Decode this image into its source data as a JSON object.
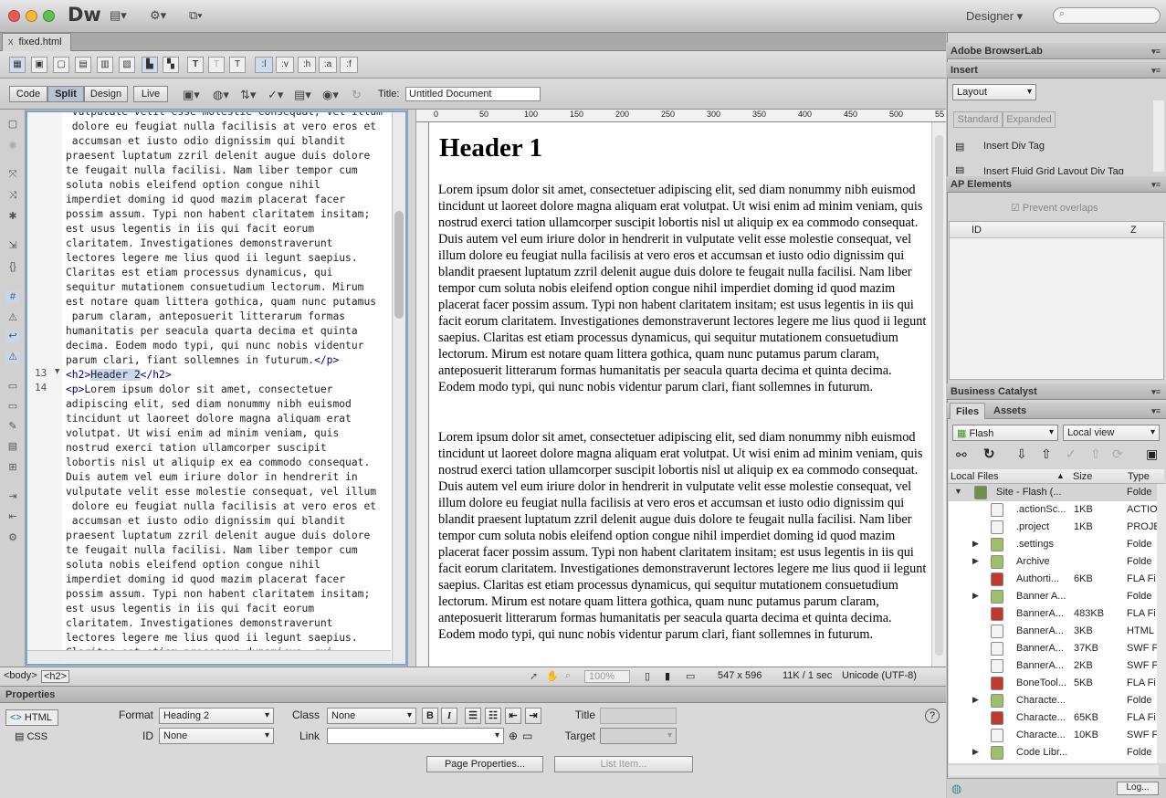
{
  "app": {
    "logo": "Dw",
    "workspace": "Designer",
    "search_placeholder": ""
  },
  "document": {
    "tab_name": "fixed.html",
    "tab_close": "x"
  },
  "insert_bar": {
    "tag_buttons": [
      ":l",
      ":v",
      ":h",
      ":a",
      ":f"
    ]
  },
  "doc_toolbar": {
    "code": "Code",
    "split": "Split",
    "design": "Design",
    "live": "Live",
    "title_label": "Title:",
    "title_value": "Untitled Document"
  },
  "code_view": {
    "line_13": "13",
    "line_14": "14",
    "text_before": " vulputate velit esse molestie consequat, vel illum\n dolore eu feugiat nulla facilisis at vero eros et\n accumsan et iusto odio dignissim qui blandit\npraesent luptatum zzril delenit augue duis dolore\nte feugait nulla facilisi. Nam liber tempor cum\nsoluta nobis eleifend option congue nihil\nimperdiet doming id quod mazim placerat facer\npossim assum. Typi non habent claritatem insitam;\nest usus legentis in iis qui facit eorum\nclaritatem. Investigationes demonstraverunt\nlectores legere me lius quod ii legunt saepius.\nClaritas est etiam processus dynamicus, qui\nsequitur mutationem consuetudium lectorum. Mirum\nest notare quam littera gothica, quam nunc putamus\n parum claram, anteposuerit litterarum formas\nhumanitatis per seacula quarta decima et quinta\ndecima. Eodem modo typi, qui nunc nobis videntur\nparum clari, fiant sollemnes in futurum.",
    "end_p": "</p>",
    "h2_open": "<h2>",
    "h2_text": "Header 2",
    "h2_close": "</h2>",
    "p_open": "<p>",
    "text_after_first": "Lorem ipsum dolor sit amet, consectetuer",
    "text_after": "adipiscing elit, sed diam nonummy nibh euismod\ntincidunt ut laoreet dolore magna aliquam erat\nvolutpat. Ut wisi enim ad minim veniam, quis\nnostrud exerci tation ullamcorper suscipit\nlobortis nisl ut aliquip ex ea commodo consequat.\nDuis autem vel eum iriure dolor in hendrerit in\nvulputate velit esse molestie consequat, vel illum\n dolore eu feugiat nulla facilisis at vero eros et\n accumsan et iusto odio dignissim qui blandit\npraesent luptatum zzril delenit augue duis dolore\nte feugait nulla facilisi. Nam liber tempor cum\nsoluta nobis eleifend option congue nihil\nimperdiet doming id quod mazim placerat facer\npossim assum. Typi non habent claritatem insitam;\nest usus legentis in iis qui facit eorum\nclaritatem. Investigationes demonstraverunt\nlectores legere me lius quod ii legunt saepius.\nClaritas est etiam processus dynamicus, qui"
  },
  "ruler": {
    "h_ticks": [
      "0",
      "50",
      "100",
      "150",
      "200",
      "250",
      "300",
      "350",
      "400",
      "450",
      "500",
      "55"
    ]
  },
  "design_view": {
    "heading": "Header 1",
    "para1": "Lorem ipsum dolor sit amet, consectetuer adipiscing elit, sed diam nonummy nibh euismod tincidunt ut laoreet dolore magna aliquam erat volutpat. Ut wisi enim ad minim veniam, quis nostrud exerci tation ullamcorper suscipit lobortis nisl ut aliquip ex ea commodo consequat. Duis autem vel eum iriure dolor in hendrerit in vulputate velit esse molestie consequat, vel illum dolore eu feugiat nulla facilisis at vero eros et accumsan et iusto odio dignissim qui blandit praesent luptatum zzril delenit augue duis dolore te feugait nulla facilisi. Nam liber tempor cum soluta nobis eleifend option congue nihil imperdiet doming id quod mazim placerat facer possim assum. Typi non habent claritatem insitam; est usus legentis in iis qui facit eorum claritatem. Investigationes demonstraverunt lectores legere me lius quod ii legunt saepius. Claritas est etiam processus dynamicus, qui sequitur mutationem consuetudium lectorum. Mirum est notare quam littera gothica, quam nunc putamus parum claram, anteposuerit litterarum formas humanitatis per seacula quarta decima et quinta decima. Eodem modo typi, qui nunc nobis videntur parum clari, fiant sollemnes in futurum.",
    "para2": "Lorem ipsum dolor sit amet, consectetuer adipiscing elit, sed diam nonummy nibh euismod tincidunt ut laoreet dolore magna aliquam erat volutpat. Ut wisi enim ad minim veniam, quis nostrud exerci tation ullamcorper suscipit lobortis nisl ut aliquip ex ea commodo consequat. Duis autem vel eum iriure dolor in hendrerit in vulputate velit esse molestie consequat, vel illum dolore eu feugiat nulla facilisis at vero eros et accumsan et iusto odio dignissim qui blandit praesent luptatum zzril delenit augue duis dolore te feugait nulla facilisi. Nam liber tempor cum soluta nobis eleifend option congue nihil imperdiet doming id quod mazim placerat facer possim assum. Typi non habent claritatem insitam; est usus legentis in iis qui facit eorum claritatem. Investigationes demonstraverunt lectores legere me lius quod ii legunt saepius. Claritas est etiam processus dynamicus, qui sequitur mutationem consuetudium lectorum. Mirum est notare quam littera gothica, quam nunc putamus parum claram, anteposuerit litterarum formas humanitatis per seacula quarta decima et quinta decima. Eodem modo typi, qui nunc nobis videntur parum clari, fiant sollemnes in futurum."
  },
  "status_bar": {
    "tag_body": "<body>",
    "tag_h2": "<h2>",
    "zoom": "100%",
    "window_size": "547 x 596",
    "download": "11K / 1 sec",
    "encoding": "Unicode (UTF-8)"
  },
  "properties": {
    "header": "Properties",
    "html_btn": "HTML",
    "css_btn": "CSS",
    "format_label": "Format",
    "format_value": "Heading 2",
    "class_label": "Class",
    "class_value": "None",
    "id_label": "ID",
    "id_value": "None",
    "link_label": "Link",
    "link_value": "",
    "title_label": "Title",
    "target_label": "Target",
    "bold": "B",
    "italic": "I",
    "page_properties": "Page Properties...",
    "list_item": "List Item...",
    "help": "?"
  },
  "right_panels": {
    "browserlab": "Adobe BrowserLab",
    "insert": "Insert",
    "layout_select": "Layout",
    "standard": "Standard",
    "expanded": "Expanded",
    "insert_div": "Insert Div Tag",
    "insert_fluid": "Insert Fluid Grid Layout Div Tag",
    "ap_elements": "AP Elements",
    "prevent_overlaps": "Prevent overlaps",
    "col_id": "ID",
    "col_z": "Z",
    "business_catalyst": "Business Catalyst",
    "files_tab": "Files",
    "assets_tab": "Assets",
    "site_select": "Flash",
    "view_select": "Local view",
    "col_local": "Local Files",
    "col_size": "Size",
    "col_type": "Type",
    "log_btn": "Log...",
    "files": [
      {
        "name": "Site - Flash (...",
        "size": "",
        "type": "Folde"
      },
      {
        "name": ".actionSc...",
        "size": "1KB",
        "type": "ACTIO"
      },
      {
        "name": ".project",
        "size": "1KB",
        "type": "PROJE"
      },
      {
        "name": ".settings",
        "size": "",
        "type": "Folde"
      },
      {
        "name": "Archive",
        "size": "",
        "type": "Folde"
      },
      {
        "name": "Authorti...",
        "size": "6KB",
        "type": "FLA Fi"
      },
      {
        "name": "Banner A...",
        "size": "",
        "type": "Folde"
      },
      {
        "name": "BannerA...",
        "size": "483KB",
        "type": "FLA Fi"
      },
      {
        "name": "BannerA...",
        "size": "3KB",
        "type": "HTML"
      },
      {
        "name": "BannerA...",
        "size": "37KB",
        "type": "SWF Fi"
      },
      {
        "name": "BannerA...",
        "size": "2KB",
        "type": "SWF Fi"
      },
      {
        "name": "BoneTool...",
        "size": "5KB",
        "type": "FLA Fi"
      },
      {
        "name": "Characte...",
        "size": "",
        "type": "Folde"
      },
      {
        "name": "Characte...",
        "size": "65KB",
        "type": "FLA Fi"
      },
      {
        "name": "Characte...",
        "size": "10KB",
        "type": "SWF Fi"
      },
      {
        "name": "Code Libr...",
        "size": "",
        "type": "Folde"
      }
    ]
  }
}
